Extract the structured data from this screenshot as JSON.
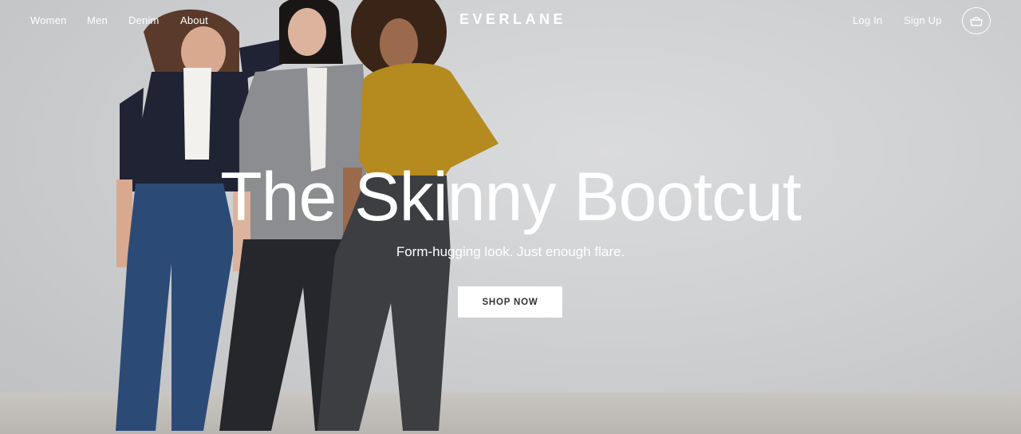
{
  "nav": {
    "left_links": [
      "Women",
      "Men",
      "Denim",
      "About"
    ],
    "logo": "EVERLANE",
    "login": "Log In",
    "signup": "Sign Up",
    "cart_icon": "bag-icon"
  },
  "hero": {
    "headline": "The Skinny Bootcut",
    "subheadline": "Form-hugging look. Just enough flare.",
    "cta": "SHOP NOW"
  },
  "colors": {
    "background": "#d3d4d6",
    "text": "#ffffff",
    "cta_bg": "#ffffff",
    "cta_text": "#333333"
  }
}
